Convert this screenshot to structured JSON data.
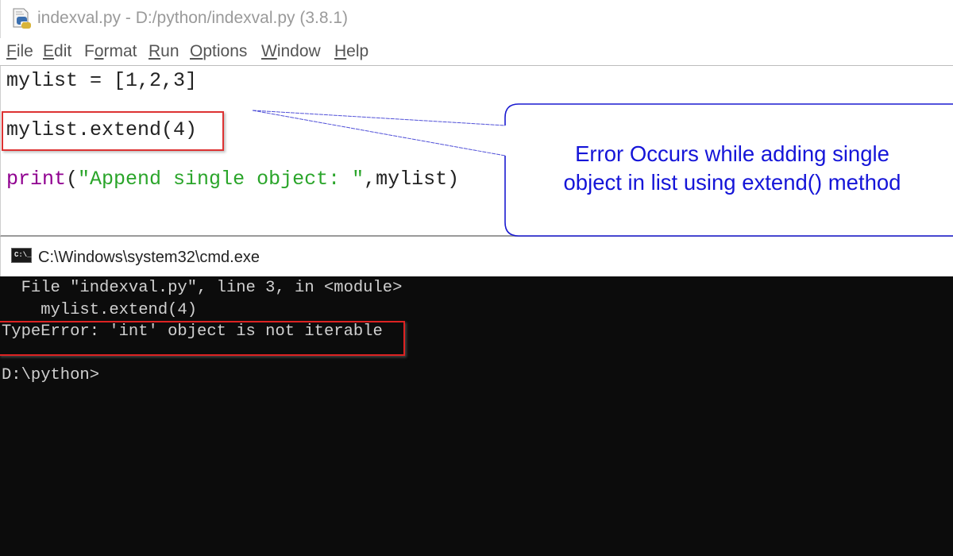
{
  "idle_window": {
    "title": "indexval.py - D:/python/indexval.py (3.8.1)",
    "icon": "python-file-icon",
    "menu": [
      {
        "label": "File",
        "mnemonic_index": 0
      },
      {
        "label": "Edit",
        "mnemonic_index": 0
      },
      {
        "label": "Format",
        "mnemonic_index": 1
      },
      {
        "label": "Run",
        "mnemonic_index": 0
      },
      {
        "label": "Options",
        "mnemonic_index": 0
      },
      {
        "label": "Window",
        "mnemonic_index": 0
      },
      {
        "label": "Help",
        "mnemonic_index": 0
      }
    ],
    "code": {
      "line1": "mylist = [1,2,3]",
      "line2": "mylist.extend(4)",
      "line3_builtin": "print",
      "line3_open": "(",
      "line3_string": "\"Append single object: \"",
      "line3_rest": ",mylist)"
    }
  },
  "annotation": {
    "text_line1": "Error Occurs while adding single",
    "text_line2": "object in list using extend() method",
    "color": "#1515d8",
    "highlight_color": "#d33333"
  },
  "cmd_window": {
    "title": "C:\\Windows\\system32\\cmd.exe",
    "icon": "cmd-icon",
    "icon_text": "C:\\_",
    "lines": [
      "  File \"indexval.py\", line 3, in <module>",
      "    mylist.extend(4)",
      "TypeError: 'int' object is not iterable",
      "",
      "D:\\python>"
    ]
  }
}
